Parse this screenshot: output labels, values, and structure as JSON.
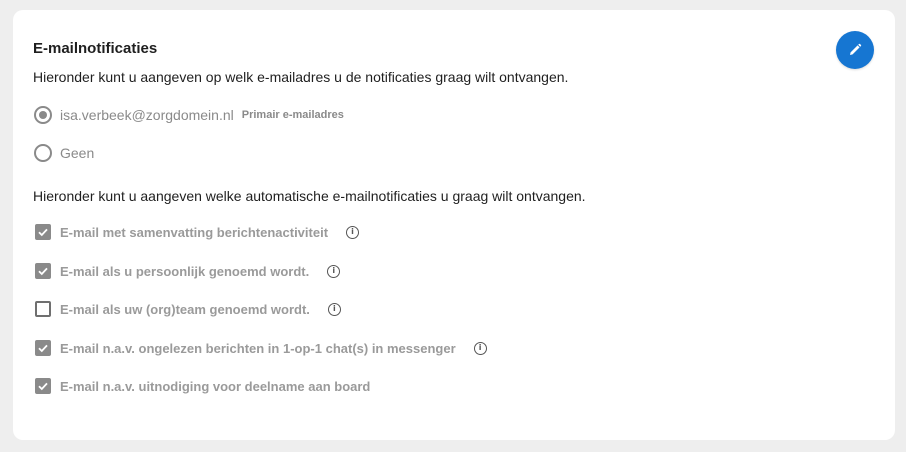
{
  "section": {
    "title": "E-mailnotificaties",
    "description_email": "Hieronder kunt u aangeven op welk e-mailadres u de notificaties graag wilt ontvangen.",
    "description_notifications": "Hieronder kunt u aangeven welke automatische e-mailnotificaties u graag wilt ontvangen."
  },
  "edit_button": {
    "icon": "pencil-icon",
    "color": "#1676d2"
  },
  "email_options": [
    {
      "label": "isa.verbeek@zorgdomein.nl",
      "sublabel": "Primair e-mailadres",
      "selected": true
    },
    {
      "label": "Geen",
      "selected": false
    }
  ],
  "notifications": [
    {
      "label": "E-mail met samenvatting berichtenactiviteit",
      "checked": true,
      "has_info": true
    },
    {
      "label": "E-mail als u persoonlijk genoemd wordt.",
      "checked": true,
      "has_info": true
    },
    {
      "label": "E-mail als uw (org)team genoemd wordt.",
      "checked": false,
      "has_info": true
    },
    {
      "label": "E-mail n.a.v. ongelezen berichten in 1-op-1 chat(s) in messenger",
      "checked": true,
      "has_info": true
    },
    {
      "label": "E-mail n.a.v. uitnodiging voor deelname aan board",
      "checked": true,
      "has_info": false
    }
  ],
  "info_icon_glyph": "i"
}
